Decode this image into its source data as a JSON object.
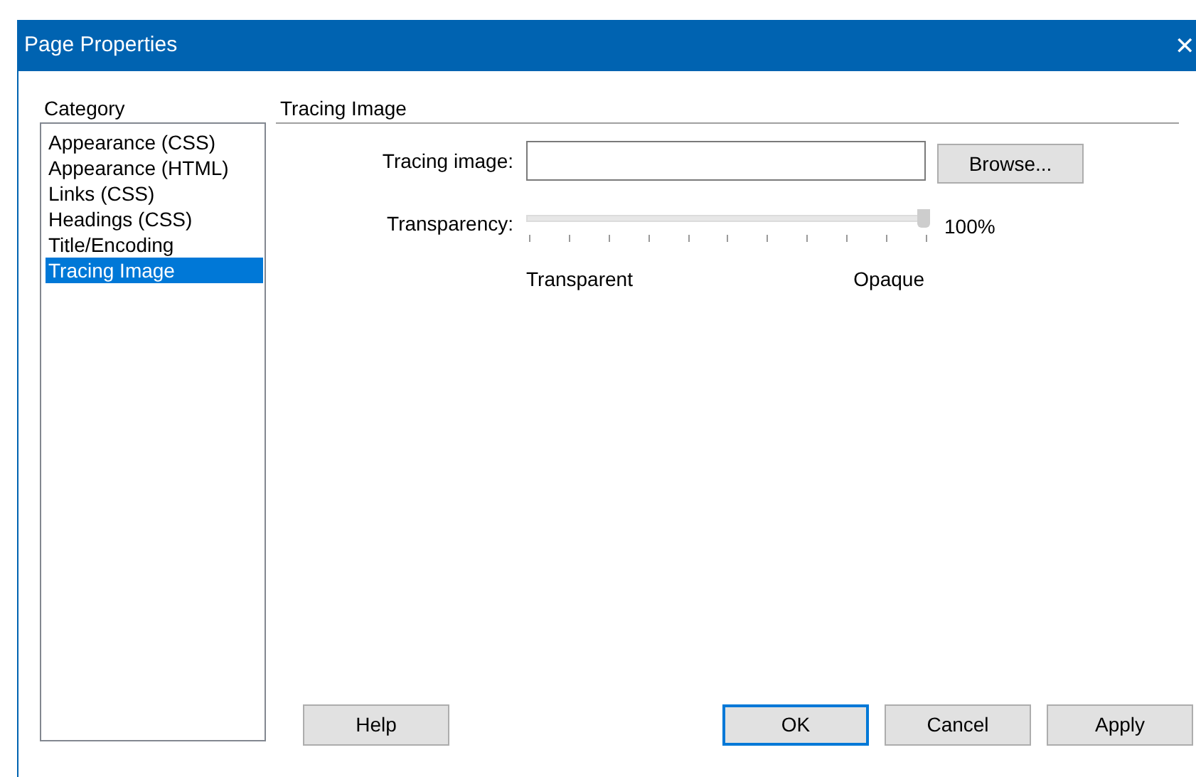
{
  "window": {
    "title": "Page Properties",
    "close": "✕"
  },
  "category": {
    "label": "Category",
    "items": [
      {
        "label": "Appearance (CSS)",
        "selected": false
      },
      {
        "label": "Appearance (HTML)",
        "selected": false
      },
      {
        "label": "Links (CSS)",
        "selected": false
      },
      {
        "label": "Headings (CSS)",
        "selected": false
      },
      {
        "label": "Title/Encoding",
        "selected": false
      },
      {
        "label": "Tracing Image",
        "selected": true
      }
    ]
  },
  "panel": {
    "heading": "Tracing Image",
    "tracing_image": {
      "label": "Tracing image:",
      "browse": "Browse..."
    },
    "transparency": {
      "label": "Transparency:",
      "level": 1,
      "reading": "100%",
      "min_label": "Transparent",
      "max_label": "Opaque"
    }
  },
  "buttons": [
    {
      "label": "Help",
      "default": false
    },
    {
      "label": "OK",
      "default": true
    },
    {
      "label": "Cancel",
      "default": false
    },
    {
      "label": "Apply",
      "default": false
    }
  ]
}
